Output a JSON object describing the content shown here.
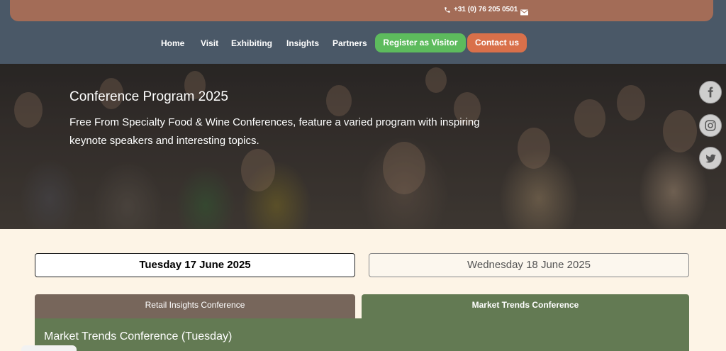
{
  "topbar": {
    "phone": "+31 (0) 76 205 0501",
    "phone_icon": "phone-icon",
    "mail_icon": "mail-icon"
  },
  "nav": {
    "items": [
      "Home",
      "Visit",
      "Exhibiting",
      "Insights",
      "Partners"
    ],
    "register": "Register as Visitor",
    "contact": "Contact us"
  },
  "hero": {
    "title": "Conference Program 2025",
    "subtitle": "Free From Specialty Food & Wine Conferences, feature a varied program with inspiring keynote speakers and interesting topics."
  },
  "social": [
    "facebook-icon",
    "instagram-icon",
    "twitter-icon"
  ],
  "days": {
    "active": "Tuesday 17 June 2025",
    "inactive": "Wednesday 18 June 2025"
  },
  "conferences": {
    "tab_a": "Retail Insights Conference",
    "tab_b": "Market Trends Conference"
  },
  "panel": {
    "title": "Market Trends Conference  (Tuesday)"
  },
  "colors": {
    "header": "#4a5867",
    "topbar": "#a36c57",
    "register": "#5dbb5d",
    "contact": "#d9704a",
    "green_tab": "#637a53",
    "brown_tab": "#77665b"
  }
}
